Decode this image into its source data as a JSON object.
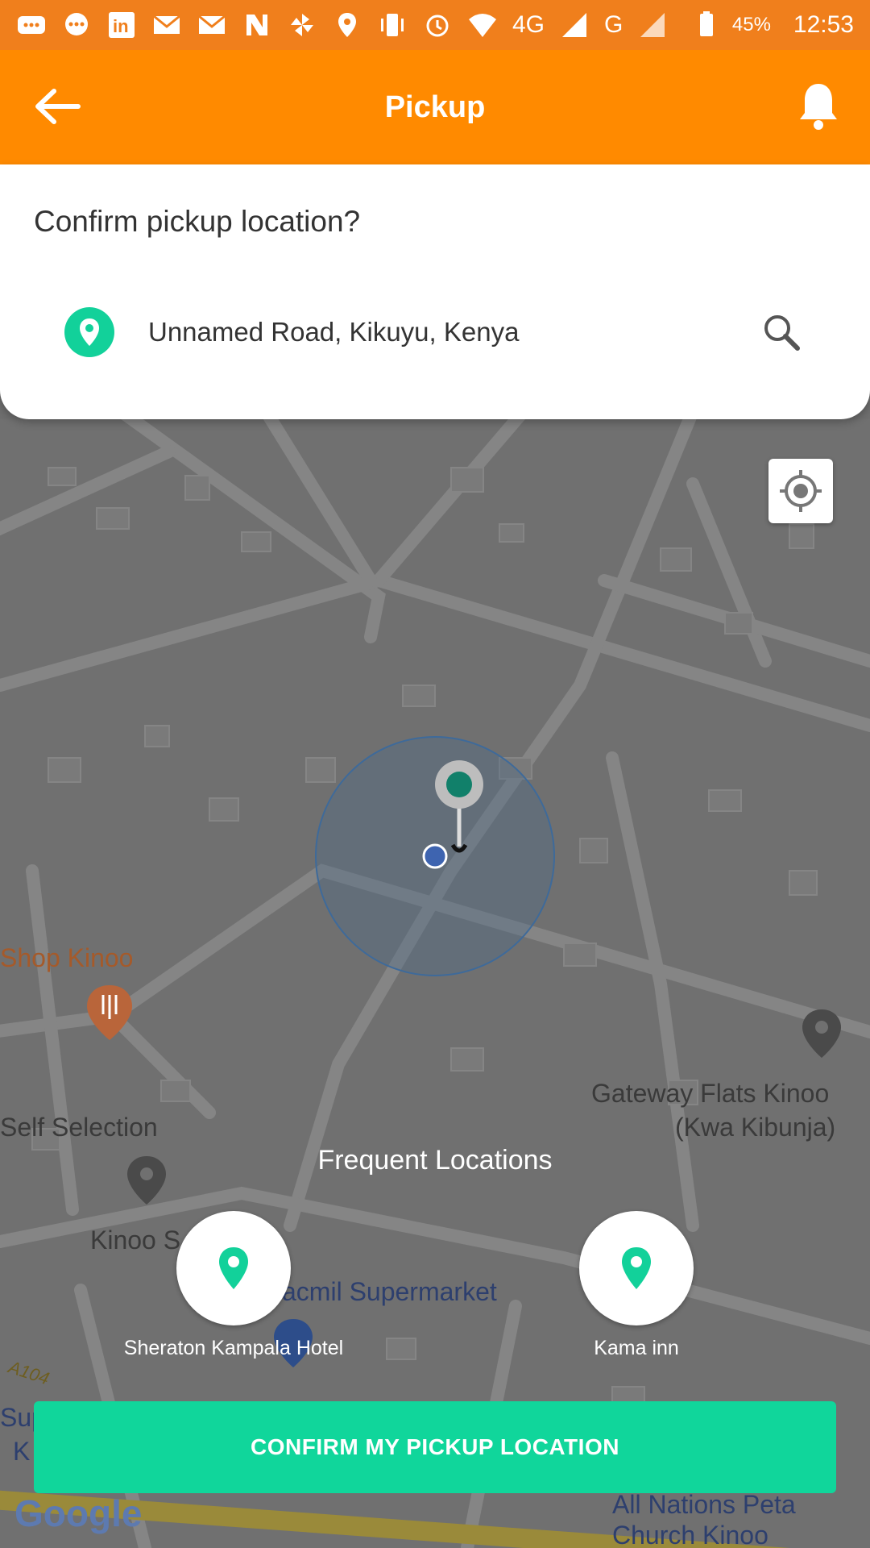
{
  "status_bar": {
    "battery": "45%",
    "time": "12:53",
    "network": "4G",
    "network2": "G",
    "icons": [
      "sms-icon",
      "chat-icon",
      "linkedin-icon",
      "gmail-icon",
      "gmail-icon",
      "n-app-icon",
      "pinwheel-icon",
      "location-icon",
      "vibrate-icon",
      "alarm-icon",
      "wifi-icon",
      "signal-icon",
      "signal-icon",
      "battery-icon"
    ]
  },
  "app_bar": {
    "title": "Pickup"
  },
  "card": {
    "question": "Confirm pickup location?",
    "address": "Unnamed Road, Kikuyu, Kenya"
  },
  "map": {
    "labels": {
      "shop": "Shop Kinoo",
      "self_selection": "Self Selection",
      "kinoo_s": "Kinoo S",
      "supermarket": "acmil Supermarket",
      "gateway_1": "Gateway Flats Kinoo",
      "gateway_2": "(Kwa Kibunja)",
      "sup": "Sup",
      "k": "K",
      "all_nations_1": "All Nations Peta",
      "all_nations_2": "Church Kinoo",
      "road": "A104"
    },
    "google": "Google"
  },
  "frequent": {
    "title": "Frequent Locations",
    "items": [
      {
        "label": "Sheraton Kampala Hotel"
      },
      {
        "label": "Kama inn"
      }
    ]
  },
  "confirm_button": "CONFIRM MY PICKUP LOCATION",
  "colors": {
    "status_bar": "#f07f1c",
    "app_bar": "#ff8a00",
    "accent": "#12d19a",
    "confirm": "#10d69b"
  }
}
